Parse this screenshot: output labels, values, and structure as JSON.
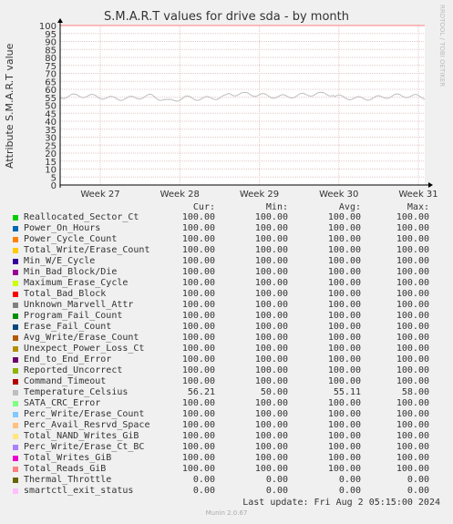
{
  "title": "S.M.A.R.T values for drive sda - by month",
  "watermark": "RRDTOOL / TOBI OETIKER",
  "footer": "Munin 2.0.67",
  "last_update": "Last update: Fri Aug  2 05:15:00 2024",
  "legend_headers": {
    "cur": "Cur:",
    "min": "Min:",
    "avg": "Avg:",
    "max": "Max:"
  },
  "chart_data": {
    "type": "line",
    "title": "S.M.A.R.T values for drive sda - by month",
    "ylabel": "Attribute S.M.A.R.T value",
    "xlabel": "",
    "ylim": [
      0,
      100
    ],
    "yticks": [
      0,
      5,
      10,
      15,
      20,
      25,
      30,
      35,
      40,
      45,
      50,
      55,
      60,
      65,
      70,
      75,
      80,
      85,
      90,
      95,
      100
    ],
    "x_tick_labels": [
      "Week 27",
      "Week 28",
      "Week 29",
      "Week 30",
      "Week 31"
    ],
    "grid": true,
    "series": [
      {
        "name": "Reallocated_Sector_Ct",
        "color": "#00cc00",
        "cur": "100.00",
        "min": "100.00",
        "avg": "100.00",
        "max": "100.00"
      },
      {
        "name": "Power_On_Hours",
        "color": "#0066b3",
        "cur": "100.00",
        "min": "100.00",
        "avg": "100.00",
        "max": "100.00"
      },
      {
        "name": "Power_Cycle_Count",
        "color": "#ff8000",
        "cur": "100.00",
        "min": "100.00",
        "avg": "100.00",
        "max": "100.00"
      },
      {
        "name": "Total_Write/Erase_Count",
        "color": "#ffcc00",
        "cur": "100.00",
        "min": "100.00",
        "avg": "100.00",
        "max": "100.00"
      },
      {
        "name": "Min_W/E_Cycle",
        "color": "#330099",
        "cur": "100.00",
        "min": "100.00",
        "avg": "100.00",
        "max": "100.00"
      },
      {
        "name": "Min_Bad_Block/Die",
        "color": "#990099",
        "cur": "100.00",
        "min": "100.00",
        "avg": "100.00",
        "max": "100.00"
      },
      {
        "name": "Maximum_Erase_Cycle",
        "color": "#ccff00",
        "cur": "100.00",
        "min": "100.00",
        "avg": "100.00",
        "max": "100.00"
      },
      {
        "name": "Total_Bad_Block",
        "color": "#ff0000",
        "cur": "100.00",
        "min": "100.00",
        "avg": "100.00",
        "max": "100.00"
      },
      {
        "name": "Unknown_Marvell_Attr",
        "color": "#808080",
        "cur": "100.00",
        "min": "100.00",
        "avg": "100.00",
        "max": "100.00"
      },
      {
        "name": "Program_Fail_Count",
        "color": "#008f00",
        "cur": "100.00",
        "min": "100.00",
        "avg": "100.00",
        "max": "100.00"
      },
      {
        "name": "Erase_Fail_Count",
        "color": "#00487d",
        "cur": "100.00",
        "min": "100.00",
        "avg": "100.00",
        "max": "100.00"
      },
      {
        "name": "Avg_Write/Erase_Count",
        "color": "#b35a00",
        "cur": "100.00",
        "min": "100.00",
        "avg": "100.00",
        "max": "100.00"
      },
      {
        "name": "Unexpect_Power_Loss_Ct",
        "color": "#b38f00",
        "cur": "100.00",
        "min": "100.00",
        "avg": "100.00",
        "max": "100.00"
      },
      {
        "name": "End_to_End_Error",
        "color": "#6b006b",
        "cur": "100.00",
        "min": "100.00",
        "avg": "100.00",
        "max": "100.00"
      },
      {
        "name": "Reported_Uncorrect",
        "color": "#8fb300",
        "cur": "100.00",
        "min": "100.00",
        "avg": "100.00",
        "max": "100.00"
      },
      {
        "name": "Command_Timeout",
        "color": "#b30000",
        "cur": "100.00",
        "min": "100.00",
        "avg": "100.00",
        "max": "100.00"
      },
      {
        "name": "Temperature_Celsius",
        "color": "#bebebe",
        "cur": "56.21",
        "min": "50.00",
        "avg": "55.11",
        "max": "58.00"
      },
      {
        "name": "SATA_CRC_Error",
        "color": "#80ff80",
        "cur": "100.00",
        "min": "100.00",
        "avg": "100.00",
        "max": "100.00"
      },
      {
        "name": "Perc_Write/Erase_Count",
        "color": "#80c9ff",
        "cur": "100.00",
        "min": "100.00",
        "avg": "100.00",
        "max": "100.00"
      },
      {
        "name": "Perc_Avail_Resrvd_Space",
        "color": "#ffc080",
        "cur": "100.00",
        "min": "100.00",
        "avg": "100.00",
        "max": "100.00"
      },
      {
        "name": "Total_NAND_Writes_GiB",
        "color": "#ffe680",
        "cur": "100.00",
        "min": "100.00",
        "avg": "100.00",
        "max": "100.00"
      },
      {
        "name": "Perc_Write/Erase_Ct_BC",
        "color": "#aa80ff",
        "cur": "100.00",
        "min": "100.00",
        "avg": "100.00",
        "max": "100.00"
      },
      {
        "name": "Total_Writes_GiB",
        "color": "#ee00cc",
        "cur": "100.00",
        "min": "100.00",
        "avg": "100.00",
        "max": "100.00"
      },
      {
        "name": "Total_Reads_GiB",
        "color": "#ff8080",
        "cur": "100.00",
        "min": "100.00",
        "avg": "100.00",
        "max": "100.00"
      },
      {
        "name": "Thermal_Throttle",
        "color": "#666600",
        "cur": "0.00",
        "min": "0.00",
        "avg": "0.00",
        "max": "0.00"
      },
      {
        "name": "smartctl_exit_status",
        "color": "#ffbfff",
        "cur": "0.00",
        "min": "0.00",
        "avg": "0.00",
        "max": "0.00"
      }
    ]
  }
}
